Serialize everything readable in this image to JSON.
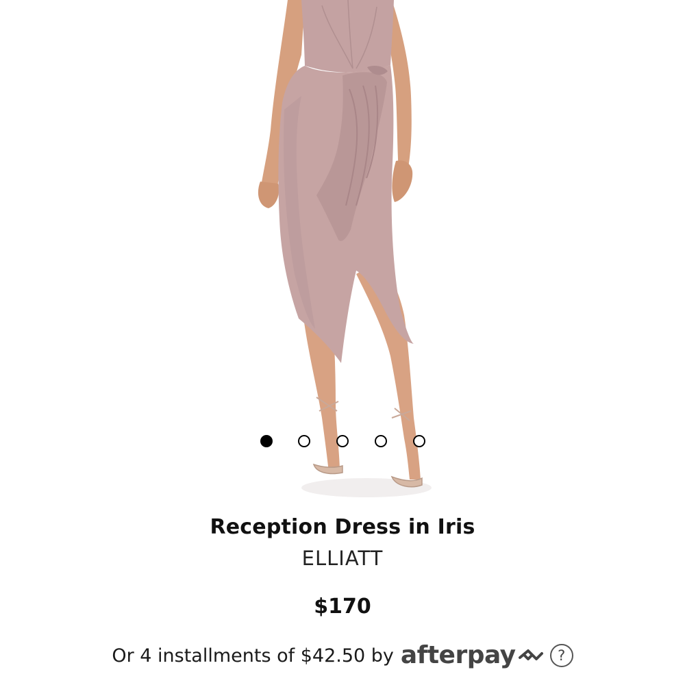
{
  "product": {
    "title": "Reception Dress in Iris",
    "brand": "ELLIATT",
    "price": "$170",
    "image_icon": "product-photo-dress"
  },
  "carousel": {
    "total": 5,
    "active_index": 0
  },
  "payment": {
    "installments_text": "Or 4 installments of $42.50 by",
    "provider_logo": "afterpay",
    "help_icon": "?"
  },
  "colors": {
    "dress": "#c9a8a6",
    "skin": "#d9a07d",
    "text": "#111111",
    "afterpay_logo": "#444444"
  }
}
